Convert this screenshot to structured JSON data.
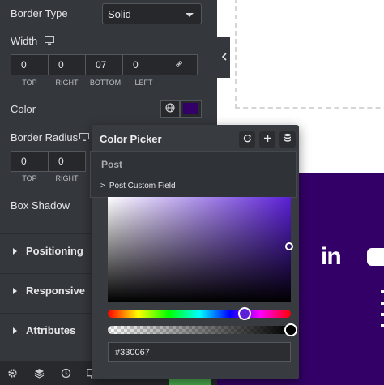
{
  "panel": {
    "border_type": {
      "label": "Border Type",
      "value": "Solid"
    },
    "width": {
      "label": "Width",
      "values": [
        "0",
        "0",
        "07",
        "0"
      ],
      "sides": [
        "TOP",
        "RIGHT",
        "BOTTOM",
        "LEFT"
      ]
    },
    "color": {
      "label": "Color",
      "swatch": "#330067"
    },
    "border_radius": {
      "label": "Border Radius",
      "values": [
        "0",
        "0"
      ],
      "sides": [
        "TOP",
        "RIGHT"
      ]
    },
    "box_shadow": {
      "label": "Box Shadow"
    },
    "sections": [
      "Positioning",
      "Responsive",
      "Attributes"
    ]
  },
  "picker": {
    "title": "Color Picker",
    "dynamic_menu": {
      "group": "Post",
      "item": "Post Custom Field"
    },
    "hex_value": "#330067",
    "hue_color": "#5a1fd6",
    "selected_color": "#330067"
  },
  "canvas": {
    "social_text": "in",
    "background": "#330067"
  },
  "footer": {
    "icons": [
      "gear-icon",
      "layers-icon",
      "history-icon",
      "desktop-icon"
    ]
  }
}
